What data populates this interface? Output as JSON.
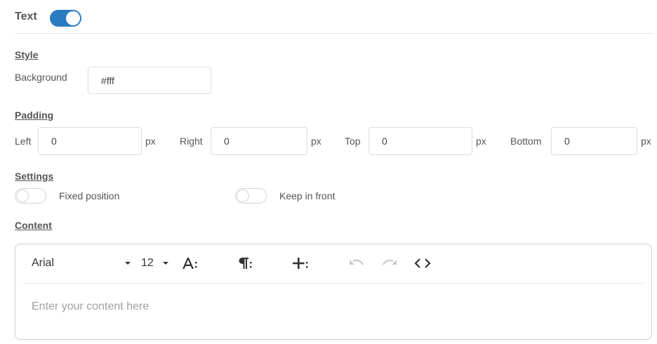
{
  "header": {
    "title": "Text",
    "enabled": true
  },
  "style": {
    "title": "Style",
    "background_label": "Background",
    "background_value": "#fff"
  },
  "padding": {
    "title": "Padding",
    "unit": "px",
    "fields": [
      {
        "label": "Left",
        "value": "0"
      },
      {
        "label": "Right",
        "value": "0"
      },
      {
        "label": "Top",
        "value": "0"
      },
      {
        "label": "Bottom",
        "value": "0"
      }
    ]
  },
  "settings": {
    "title": "Settings",
    "fixed_position": {
      "label": "Fixed position",
      "enabled": false
    },
    "keep_in_front": {
      "label": "Keep in front",
      "enabled": false
    }
  },
  "content": {
    "title": "Content",
    "toolbar": {
      "font_family": "Arial",
      "font_size": "12",
      "icons": [
        "font-style-icon",
        "paragraph-icon",
        "insert-icon",
        "undo-icon",
        "redo-icon",
        "code-view-icon"
      ]
    },
    "placeholder": "Enter your content here"
  },
  "colors": {
    "accent": "#2b7bc1",
    "text": "#555555",
    "border": "#dcdcdc"
  }
}
